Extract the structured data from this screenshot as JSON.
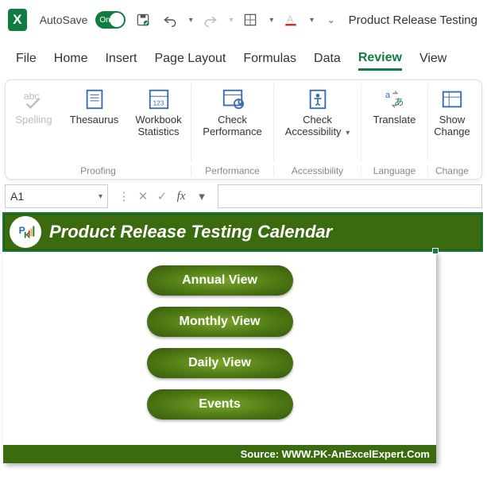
{
  "titlebar": {
    "autosave_label": "AutoSave",
    "autosave_state": "On",
    "doc_title": "Product Release Testing"
  },
  "menu": {
    "tabs": [
      "File",
      "Home",
      "Insert",
      "Page Layout",
      "Formulas",
      "Data",
      "Review",
      "View"
    ],
    "active": "Review"
  },
  "ribbon": {
    "groups": [
      {
        "label": "Proofing",
        "items": [
          {
            "name": "spelling",
            "label": "Spelling",
            "disabled": true
          },
          {
            "name": "thesaurus",
            "label": "Thesaurus"
          },
          {
            "name": "workbook-statistics",
            "label": "Workbook Statistics"
          }
        ]
      },
      {
        "label": "Performance",
        "items": [
          {
            "name": "check-performance",
            "label": "Check Performance"
          }
        ]
      },
      {
        "label": "Accessibility",
        "items": [
          {
            "name": "check-accessibility",
            "label": "Check Accessibility",
            "dropdown": true
          }
        ]
      },
      {
        "label": "Language",
        "items": [
          {
            "name": "translate",
            "label": "Translate"
          }
        ]
      },
      {
        "label": "Change",
        "items": [
          {
            "name": "show-changes",
            "label": "Show Change"
          }
        ]
      }
    ]
  },
  "formula_bar": {
    "name_box": "A1",
    "formula": ""
  },
  "sheet": {
    "banner_title": "Product Release Testing Calendar",
    "nav_buttons": [
      "Annual View",
      "Monthly View",
      "Daily View",
      "Events"
    ],
    "source_label": "Source: WWW.PK-AnExcelExpert.Com"
  },
  "colors": {
    "excel_green": "#107c41",
    "banner_green": "#3b6b0f"
  }
}
